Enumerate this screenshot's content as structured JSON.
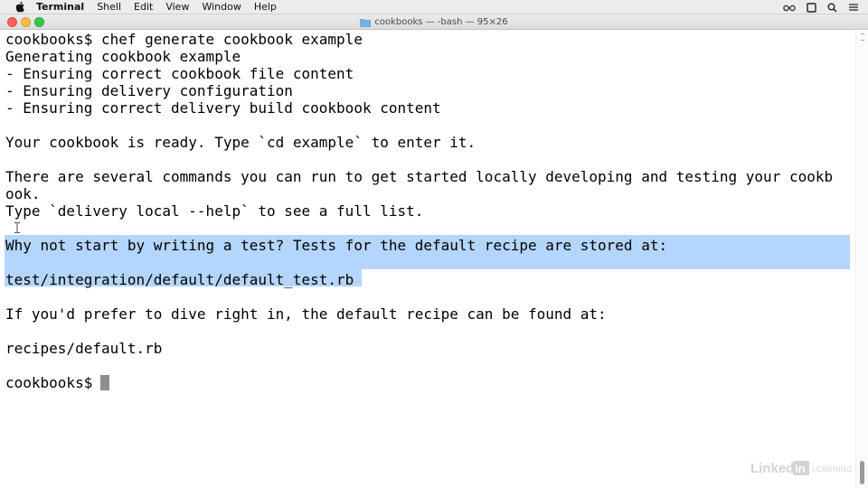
{
  "menubar": {
    "app_name": "Terminal",
    "items": [
      "Shell",
      "Edit",
      "View",
      "Window",
      "Help"
    ],
    "status_icons": [
      "glasses-icon",
      "window-icon",
      "search-icon",
      "list-icon"
    ]
  },
  "window": {
    "title": "cookbooks — -bash — 95×26",
    "icon": "folder-icon"
  },
  "terminal": {
    "lines": [
      "cookbooks$ chef generate cookbook example",
      "Generating cookbook example",
      "- Ensuring correct cookbook file content",
      "- Ensuring delivery configuration",
      "- Ensuring correct delivery build cookbook content",
      "",
      "Your cookbook is ready. Type `cd example` to enter it.",
      "",
      "There are several commands you can run to get started locally developing and testing your cookb",
      "ook.",
      "Type `delivery local --help` to see a full list.",
      "",
      "Why not start by writing a test? Tests for the default recipe are stored at:",
      "",
      "test/integration/default/default_test.rb",
      "",
      "If you'd prefer to dive right in, the default recipe can be found at:",
      "",
      "recipes/default.rb",
      "",
      "cookbooks$"
    ],
    "selected_lines": [
      12,
      13,
      14
    ]
  },
  "watermark": {
    "text_left": "Linked",
    "text_box": "in",
    "text_right": "LEARNING"
  },
  "colors": {
    "selection": "#b4d5fe",
    "close": "#fc615d",
    "minimize": "#fdbc40",
    "maximize": "#34c84a"
  }
}
